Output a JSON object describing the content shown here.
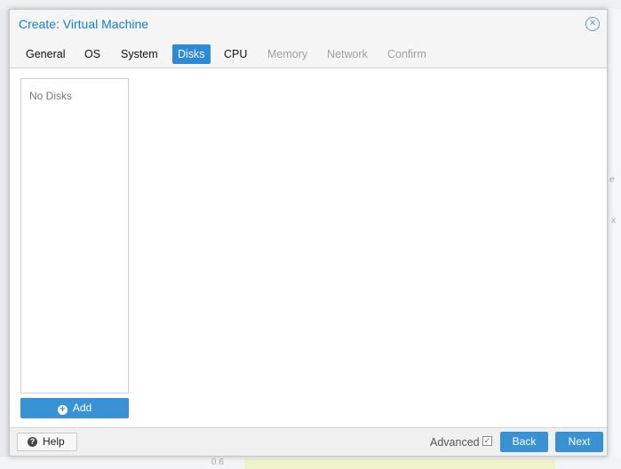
{
  "dialog": {
    "title": "Create: Virtual Machine",
    "close_icon": "close-icon"
  },
  "tabs": [
    {
      "label": "General",
      "state": "enabled"
    },
    {
      "label": "OS",
      "state": "enabled"
    },
    {
      "label": "System",
      "state": "enabled"
    },
    {
      "label": "Disks",
      "state": "active"
    },
    {
      "label": "CPU",
      "state": "enabled"
    },
    {
      "label": "Memory",
      "state": "disabled"
    },
    {
      "label": "Network",
      "state": "disabled"
    },
    {
      "label": "Confirm",
      "state": "disabled"
    }
  ],
  "disks": {
    "empty_text": "No Disks",
    "add_label": "Add",
    "add_icon": "plus-circle-icon"
  },
  "footer": {
    "help_label": "Help",
    "help_icon": "question-circle-icon",
    "advanced_label": "Advanced",
    "advanced_checked": true,
    "back_label": "Back",
    "next_label": "Next"
  },
  "background": {
    "axis_tick": "0.6",
    "side_letters": [
      "e",
      "x"
    ]
  },
  "colors": {
    "accent": "#2d8ad6",
    "title": "#157fcc",
    "disabled_text": "#a0a0a0"
  }
}
